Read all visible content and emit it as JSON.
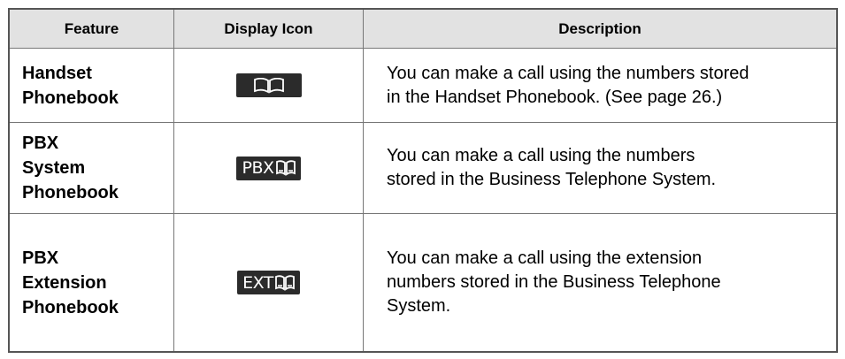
{
  "headers": [
    "Feature",
    "Display Icon",
    "Description"
  ],
  "rows": [
    {
      "feature_lines": [
        "Handset",
        "Phonebook"
      ],
      "icon": {
        "name": "phonebook-icon",
        "text": ""
      },
      "description_lines": [
        "You can make a call using the numbers stored",
        "in the Handset Phonebook. (See page 26.)"
      ]
    },
    {
      "feature_lines": [
        "PBX",
        "System",
        "Phonebook"
      ],
      "icon": {
        "name": "pbx-phonebook-icon",
        "text": "PBX"
      },
      "description_lines": [
        "You can make a call using the numbers",
        "stored in the Business Telephone System."
      ]
    },
    {
      "feature_lines": [
        "PBX",
        "Extension",
        "Phonebook"
      ],
      "icon": {
        "name": "ext-phonebook-icon",
        "text": "EXT"
      },
      "description_lines": [
        "You can make a call using the extension",
        "numbers stored in the Business Telephone",
        "System."
      ]
    }
  ],
  "colors": {
    "header_bg": "#e2e2e2",
    "icon_bg": "#2b2b2b",
    "border": "#555555"
  }
}
